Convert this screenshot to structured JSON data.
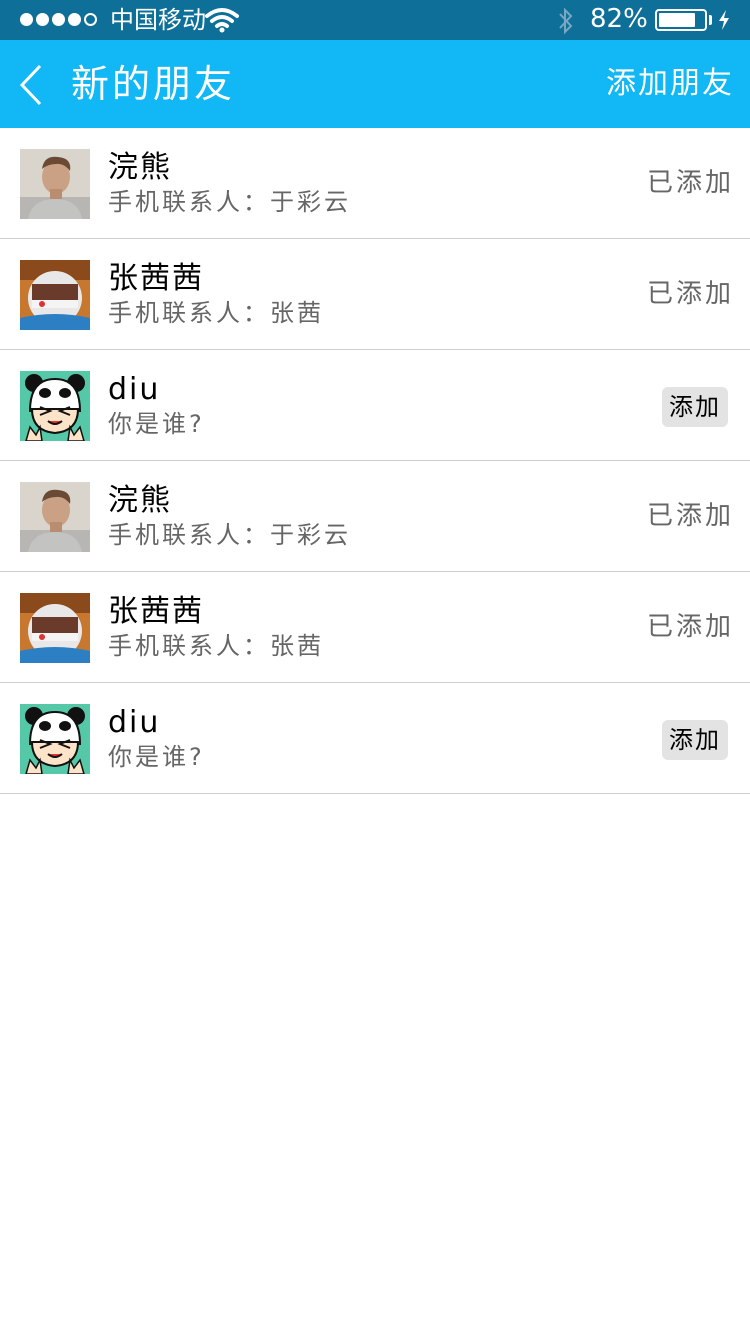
{
  "status_bar": {
    "carrier": "中国移动",
    "signal_strength": 4,
    "signal_max": 5,
    "battery_percent": "82%",
    "battery_level": 0.82,
    "icons": [
      "wifi-icon",
      "bluetooth-icon",
      "battery-icon",
      "charging-icon"
    ]
  },
  "nav": {
    "title": "新的朋友",
    "action": "添加朋友",
    "back_icon": "chevron-left-icon",
    "background": "#12b7f5"
  },
  "contacts": [
    {
      "avatar": "man-photo",
      "name": "浣熊",
      "subtitle": "手机联系人：于彩云",
      "added": true,
      "status": "已添加"
    },
    {
      "avatar": "astronaut-photo",
      "name": "张茜茜",
      "subtitle": "手机联系人：张茜",
      "added": true,
      "status": "已添加"
    },
    {
      "avatar": "panda-cartoon",
      "name": "diu",
      "subtitle": "你是谁?",
      "added": false,
      "status": "添加"
    },
    {
      "avatar": "man-photo",
      "name": "浣熊",
      "subtitle": "手机联系人：于彩云",
      "added": true,
      "status": "已添加"
    },
    {
      "avatar": "astronaut-photo",
      "name": "张茜茜",
      "subtitle": "手机联系人：张茜",
      "added": true,
      "status": "已添加"
    },
    {
      "avatar": "panda-cartoon",
      "name": "diu",
      "subtitle": "你是谁?",
      "added": false,
      "status": "添加"
    }
  ]
}
